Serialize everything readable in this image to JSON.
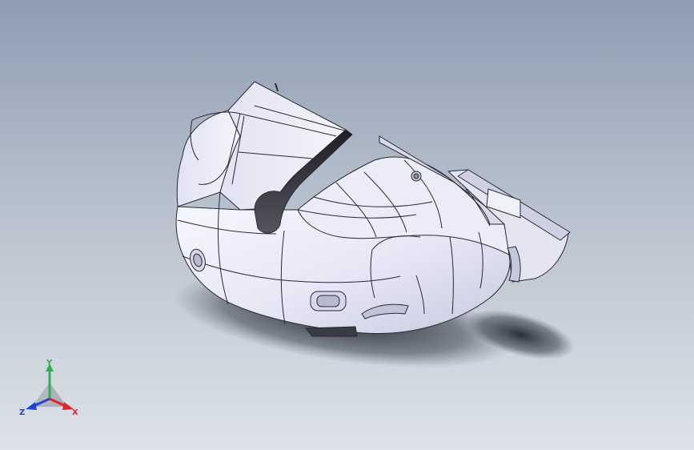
{
  "viewport": {
    "background_top": "#8f9db2",
    "background_bottom": "#dde2e8"
  },
  "model": {
    "shaded_color": "#e9e9f7",
    "edge_color": "#2a2a34",
    "shadow_color": "#2e3440"
  },
  "triad": {
    "x_label": "X",
    "y_label": "Y",
    "z_label": "Z",
    "x_color": "#e0262b",
    "y_color": "#2db34a",
    "z_color": "#2740d0"
  }
}
